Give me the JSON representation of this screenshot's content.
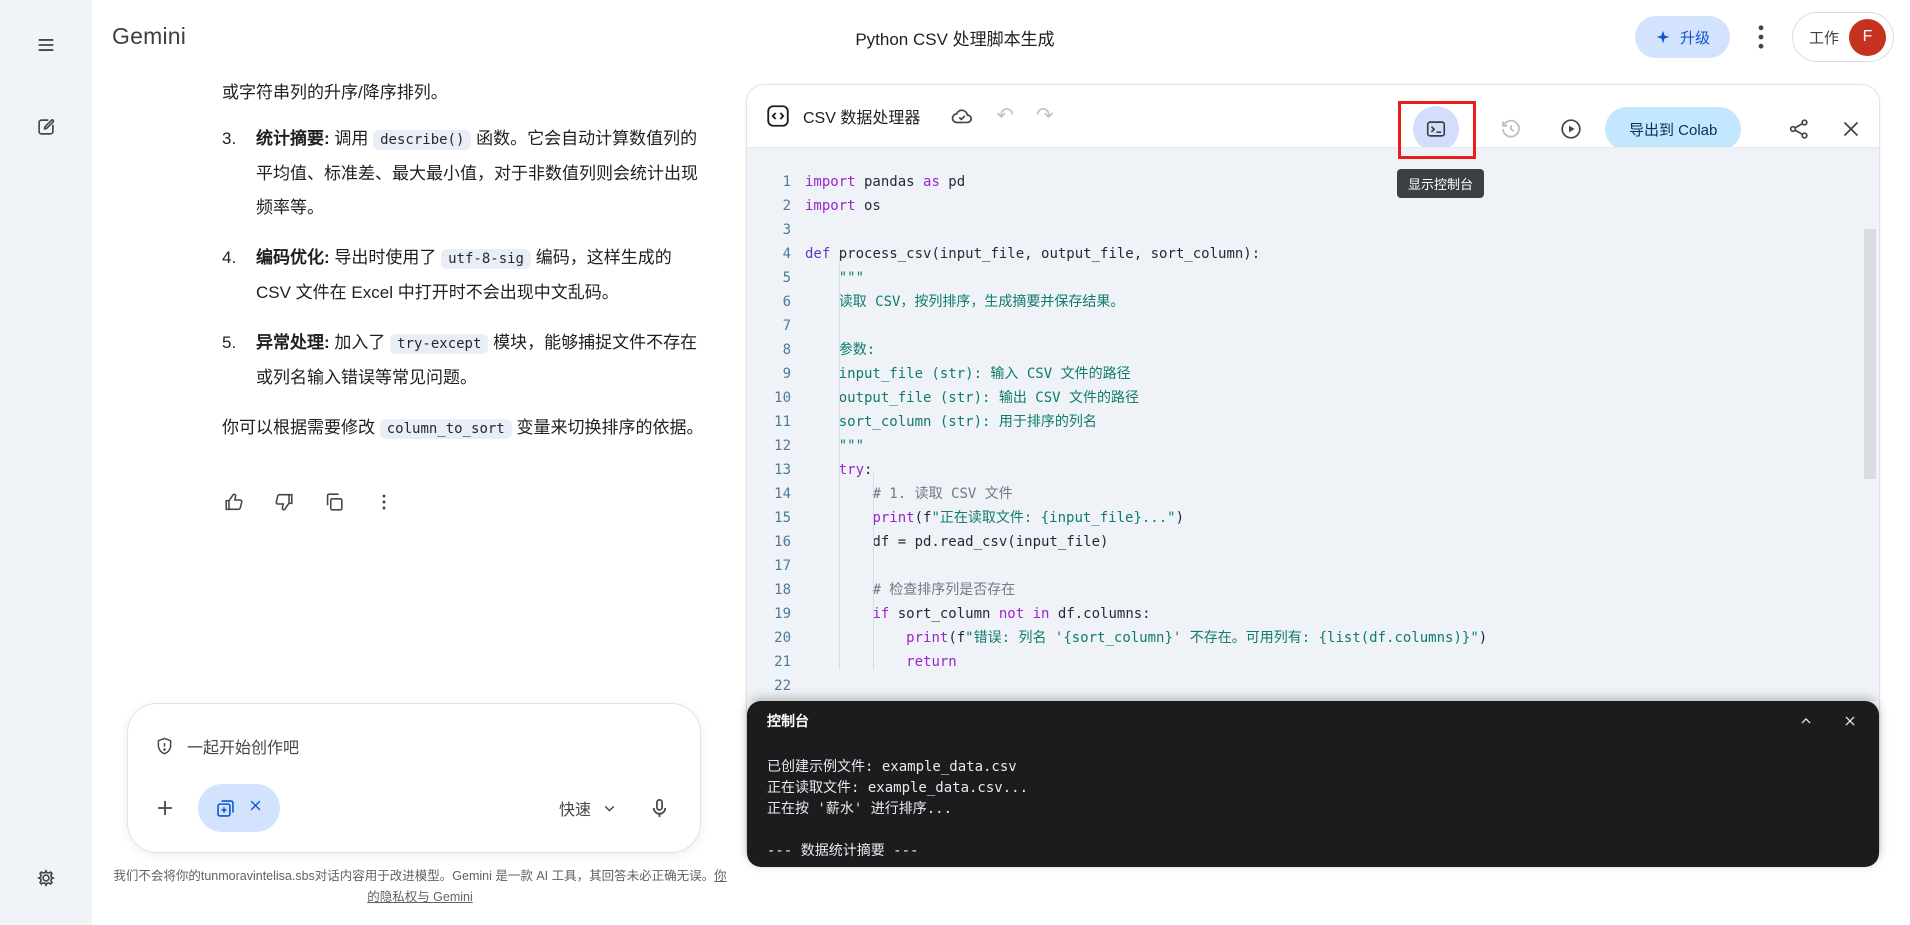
{
  "colors": {
    "accent_blue": "#0b57d0",
    "chip_blue": "#d3e3fd",
    "colab_bg": "#c2e7ff",
    "colab_text": "#05345c",
    "avatar_red": "#c5321f",
    "annotation_red": "#ea1d1d",
    "sidebar_bg": "#f0f4f9",
    "code_bg": "#eff3f8",
    "console_bg": "#1b1c1e",
    "console_text": "#e8eaed",
    "tooltip_bg": "#3c4043",
    "toggle_bg": "#d3defc",
    "code_keyword": "#9a25c9",
    "code_def": "#5f35c9",
    "code_string": "#0f7b6c",
    "code_comment": "#6d7b85",
    "code_lineno": "#4d7a97",
    "code_text": "#1f2937"
  },
  "header": {
    "logo": "Gemini",
    "title": "Python CSV 处理脚本生成",
    "upgrade_label": "升级",
    "workspace_label": "工作",
    "avatar_letter": "F"
  },
  "sidebar": {
    "icons": [
      "menu",
      "new-chat",
      "settings"
    ]
  },
  "message": {
    "clipped_line": "或字符串列的升序/降序排列。",
    "items": [
      {
        "num": "3.",
        "segments": [
          {
            "t": "统计摘要: ",
            "b": true
          },
          {
            "t": "调用 "
          },
          {
            "t": "describe()",
            "code": true
          },
          {
            "t": " 函数。它会自动计算数值列的平均值、标准差、最大最小值，对于非数值列则会统计出现频率等。"
          }
        ]
      },
      {
        "num": "4.",
        "segments": [
          {
            "t": "编码优化: ",
            "b": true
          },
          {
            "t": "导出时使用了 "
          },
          {
            "t": "utf-8-sig",
            "code": true
          },
          {
            "t": " 编码，这样生成的 CSV 文件在 Excel 中打开时不会出现中文乱码。"
          }
        ]
      },
      {
        "num": "5.",
        "segments": [
          {
            "t": "异常处理: ",
            "b": true
          },
          {
            "t": "加入了 "
          },
          {
            "t": "try-except",
            "code": true
          },
          {
            "t": " 模块，能够捕捉文件不存在或列名输入错误等常见问题。"
          }
        ]
      }
    ],
    "closing": [
      {
        "t": "你可以根据需要修改 "
      },
      {
        "t": "column_to_sort",
        "code": true
      },
      {
        "t": " 变量来切换排序的依据。"
      }
    ],
    "actions": [
      "thumbs-up",
      "thumbs-down",
      "copy",
      "more"
    ]
  },
  "composer": {
    "placeholder": "一起开始创作吧",
    "mode_label": "快速",
    "footer_text": "我们不会将你的tunmoravintelisa.sbs对话内容用于改进模型。Gemini 是一款 AI 工具，其回答未必正确无误。",
    "footer_link": "你的隐私权与 Gemini"
  },
  "canvas": {
    "title": "CSV 数据处理器",
    "export_label": "导出到 Colab",
    "tooltip": "显示控制台",
    "undo_glyph": "↶",
    "redo_glyph": "↷",
    "code": {
      "lines": [
        [
          {
            "t": "import",
            "c": "kw"
          },
          {
            "t": " pandas "
          },
          {
            "t": "as",
            "c": "kw"
          },
          {
            "t": " pd"
          }
        ],
        [
          {
            "t": "import",
            "c": "kw"
          },
          {
            "t": " os"
          }
        ],
        [],
        [
          {
            "t": "def",
            "c": "def"
          },
          {
            "t": " process_csv(input_file, output_file, sort_column):"
          }
        ],
        [
          {
            "t": "    \"\"\"",
            "c": "str"
          }
        ],
        [
          {
            "t": "    读取 CSV，按列排序，生成摘要并保存结果。",
            "c": "str"
          }
        ],
        [],
        [
          {
            "t": "    参数:",
            "c": "str"
          }
        ],
        [
          {
            "t": "    input_file (str): 输入 CSV 文件的路径",
            "c": "str"
          }
        ],
        [
          {
            "t": "    output_file (str): 输出 CSV 文件的路径",
            "c": "str"
          }
        ],
        [
          {
            "t": "    sort_column (str): 用于排序的列名",
            "c": "str"
          }
        ],
        [
          {
            "t": "    \"\"\"",
            "c": "str"
          }
        ],
        [
          {
            "t": "    "
          },
          {
            "t": "try",
            "c": "kw"
          },
          {
            "t": ":"
          }
        ],
        [
          {
            "t": "        "
          },
          {
            "t": "# 1. 读取 CSV 文件",
            "c": "com"
          }
        ],
        [
          {
            "t": "        "
          },
          {
            "t": "print",
            "c": "kw"
          },
          {
            "t": "(f"
          },
          {
            "t": "\"正在读取文件: {input_file}...\"",
            "c": "str"
          },
          {
            "t": ")"
          }
        ],
        [
          {
            "t": "        df = pd.read_csv(input_file)"
          }
        ],
        [],
        [
          {
            "t": "        "
          },
          {
            "t": "# 检查排序列是否存在",
            "c": "com"
          }
        ],
        [
          {
            "t": "        "
          },
          {
            "t": "if",
            "c": "kw"
          },
          {
            "t": " sort_column "
          },
          {
            "t": "not",
            "c": "kw"
          },
          {
            "t": " "
          },
          {
            "t": "in",
            "c": "kw"
          },
          {
            "t": " df.columns:"
          }
        ],
        [
          {
            "t": "            "
          },
          {
            "t": "print",
            "c": "kw"
          },
          {
            "t": "(f"
          },
          {
            "t": "\"错误: 列名 '{sort_column}' 不存在。可用列有: {list(df.columns)}\"",
            "c": "str"
          },
          {
            "t": ")"
          }
        ],
        [
          {
            "t": "            "
          },
          {
            "t": "return",
            "c": "kw"
          }
        ],
        []
      ]
    }
  },
  "console": {
    "title": "控制台",
    "lines": [
      "已创建示例文件: example_data.csv",
      "正在读取文件: example_data.csv...",
      "正在按 '薪水' 进行排序...",
      "",
      "--- 数据统计摘要 ---"
    ]
  }
}
